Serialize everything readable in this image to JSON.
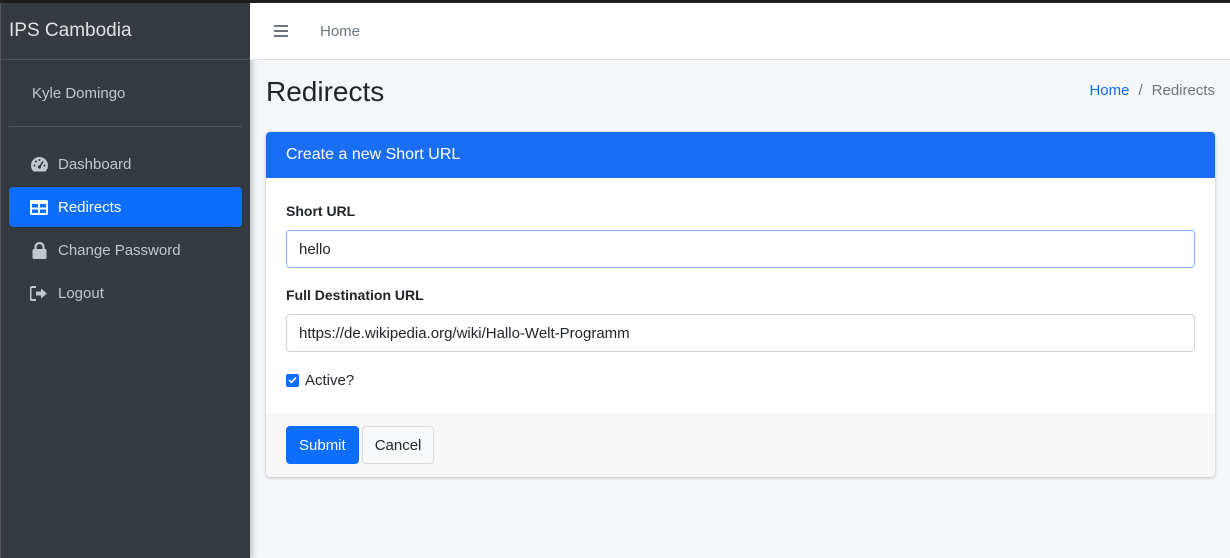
{
  "brand": {
    "name": "IPS Cambodia"
  },
  "user": {
    "name": "Kyle Domingo"
  },
  "sidebar": {
    "items": [
      {
        "label": "Dashboard",
        "icon": "tachometer-icon",
        "active": false
      },
      {
        "label": "Redirects",
        "icon": "table-icon",
        "active": true
      },
      {
        "label": "Change Password",
        "icon": "lock-icon",
        "active": false
      },
      {
        "label": "Logout",
        "icon": "sign-out-icon",
        "active": false
      }
    ]
  },
  "topbar": {
    "menu_icon": "hamburger-icon",
    "home_link": "Home"
  },
  "page": {
    "title": "Redirects",
    "breadcrumb": {
      "home": "Home",
      "separator": "/",
      "current": "Redirects"
    }
  },
  "card": {
    "title": "Create a new Short URL",
    "short_url": {
      "label": "Short URL",
      "value": "hello"
    },
    "destination_url": {
      "label": "Full Destination URL",
      "value": "https://de.wikipedia.org/wiki/Hallo-Welt-Programm"
    },
    "active": {
      "label": "Active?",
      "checked": true
    },
    "submit_label": "Submit",
    "cancel_label": "Cancel"
  },
  "colors": {
    "sidebar_bg": "#343a40",
    "accent": "#0d6efd",
    "header_bg": "#1a6ef5",
    "content_bg": "#f4f6f9"
  }
}
